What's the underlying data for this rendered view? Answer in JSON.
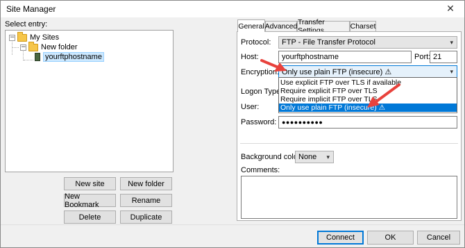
{
  "window": {
    "title": "Site Manager"
  },
  "tree": {
    "label": "Select entry:",
    "items": [
      {
        "label": "My Sites"
      },
      {
        "label": "New folder"
      },
      {
        "label": "yourftphostname"
      }
    ]
  },
  "buttons": {
    "new_site": "New site",
    "new_folder": "New folder",
    "new_bookmark": "New Bookmark",
    "rename": "Rename",
    "delete": "Delete",
    "duplicate": "Duplicate",
    "connect": "Connect",
    "ok": "OK",
    "cancel": "Cancel"
  },
  "tabs": [
    "General",
    "Advanced",
    "Transfer Settings",
    "Charset"
  ],
  "general": {
    "protocol_label": "Protocol:",
    "protocol_value": "FTP - File Transfer Protocol",
    "host_label": "Host:",
    "host_value": "yourftphostname",
    "port_label": "Port:",
    "port_value": "21",
    "encryption_label": "Encryption:",
    "encryption_value": "Only use plain FTP (insecure) ⚠",
    "encryption_options": [
      "Use explicit FTP over TLS if available",
      "Require explicit FTP over TLS",
      "Require implicit FTP over TLS",
      "Only use plain FTP (insecure) ⚠"
    ],
    "logon_label": "Logon Type:",
    "user_label": "User:",
    "password_label": "Password:",
    "password_value": "●●●●●●●●●●",
    "bg_color_label": "Background color:",
    "bg_color_value": "None",
    "comments_label": "Comments:"
  },
  "colors": {
    "accent": "#0078d7",
    "annotation_arrow": "#e8423c"
  }
}
